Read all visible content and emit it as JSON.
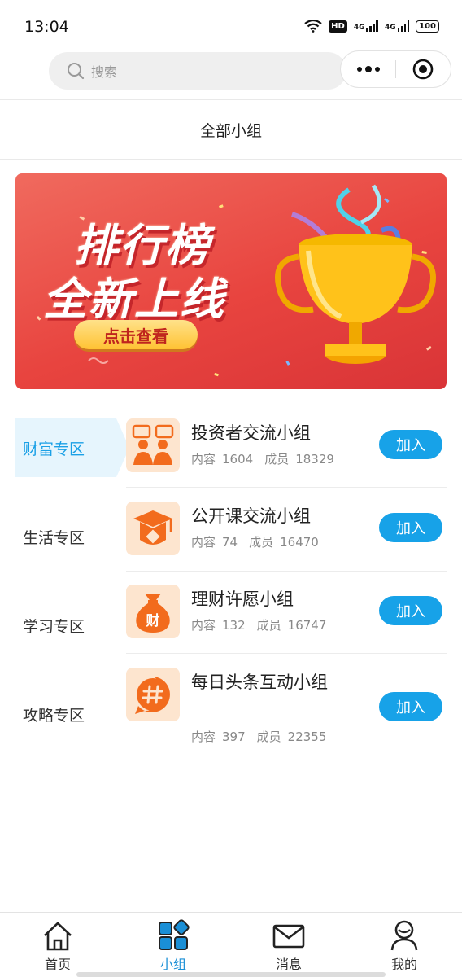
{
  "status": {
    "time": "13:04",
    "hd": "HD",
    "net1": "4G",
    "net2": "4G",
    "battery": "100"
  },
  "search": {
    "placeholder": "搜索"
  },
  "header": {
    "title": "全部小组"
  },
  "banner": {
    "line1": "排行榜",
    "line2": "全新上线",
    "button": "点击查看"
  },
  "categories": [
    {
      "label": "财富专区",
      "active": true
    },
    {
      "label": "生活专区",
      "active": false
    },
    {
      "label": "学习专区",
      "active": false
    },
    {
      "label": "攻略专区",
      "active": false
    }
  ],
  "groups": [
    {
      "name": "投资者交流小组",
      "content_label": "内容",
      "content_count": "1604",
      "member_label": "成员",
      "member_count": "18329",
      "join": "加入",
      "icon": "investor-chat-icon"
    },
    {
      "name": "公开课交流小组",
      "content_label": "内容",
      "content_count": "74",
      "member_label": "成员",
      "member_count": "16470",
      "join": "加入",
      "icon": "graduation-cap-icon"
    },
    {
      "name": "理财许愿小组",
      "content_label": "内容",
      "content_count": "132",
      "member_label": "成员",
      "member_count": "16747",
      "join": "加入",
      "icon": "money-bag-icon",
      "icon_text": "财"
    },
    {
      "name": "每日头条互动小组",
      "content_label": "内容",
      "content_count": "397",
      "member_label": "成员",
      "member_count": "22355",
      "join": "加入",
      "icon": "hashtag-icon"
    }
  ],
  "tabs": [
    {
      "label": "首页",
      "icon": "home-icon",
      "active": false
    },
    {
      "label": "小组",
      "icon": "groups-grid-icon",
      "active": true
    },
    {
      "label": "消息",
      "icon": "mail-icon",
      "active": false
    },
    {
      "label": "我的",
      "icon": "profile-icon",
      "active": false
    }
  ],
  "colors": {
    "accent": "#17a2e8",
    "active_category_bg": "#e6f5fd",
    "icon_bg": "#fde5cf",
    "icon_orange": "#f26b1d",
    "banner_red": "#e8443f"
  }
}
